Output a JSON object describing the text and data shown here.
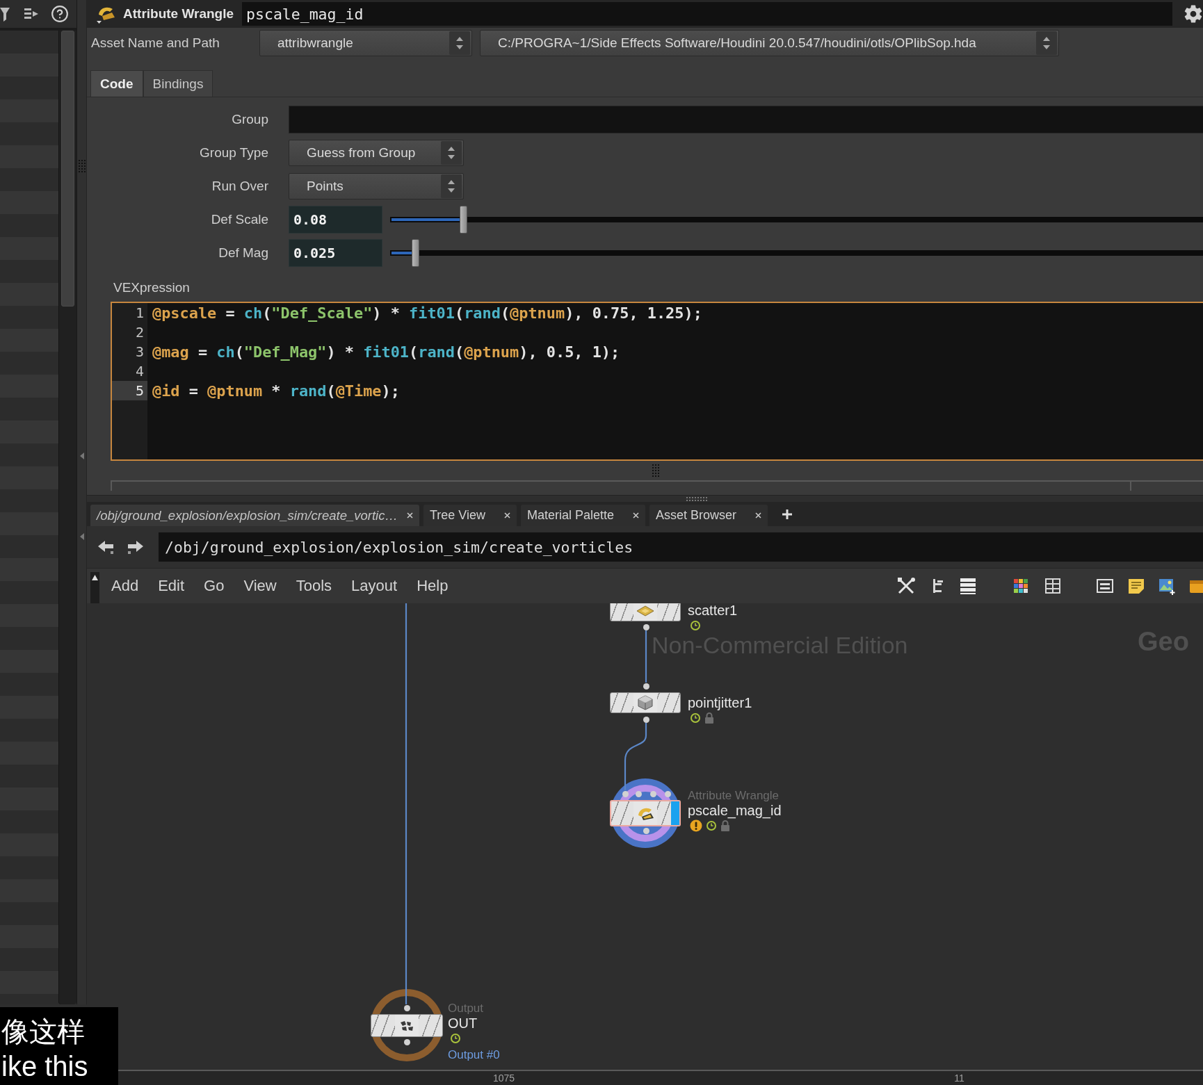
{
  "header": {
    "node_type": "Attribute Wrangle",
    "node_name": "pscale_mag_id"
  },
  "asset": {
    "label": "Asset Name and Path",
    "name": "attribwrangle",
    "path": "C:/PROGRA~1/Side Effects Software/Houdini 20.0.547/houdini/otls/OPlibSop.hda"
  },
  "parameter_tabs": [
    {
      "label": "Code",
      "selected": true
    },
    {
      "label": "Bindings",
      "selected": false
    }
  ],
  "parameters": [
    {
      "kind": "text",
      "label": "Group"
    },
    {
      "kind": "menu",
      "label": "Group Type",
      "value": "Guess from Group"
    },
    {
      "kind": "menu",
      "label": "Run Over",
      "value": "Points"
    },
    {
      "kind": "slider",
      "label": "Def Scale",
      "value": "0.08",
      "level": 0.08
    },
    {
      "kind": "slider",
      "label": "Def Mag",
      "value": "0.025",
      "level": 0.025
    }
  ],
  "code_editor": {
    "label": "VEXpression",
    "lines": [
      {
        "number": "1",
        "current": false,
        "tokens": [
          {
            "kind": "attribute",
            "text": "@pscale"
          },
          {
            "kind": "plain",
            "text": " = "
          },
          {
            "kind": "function",
            "text": "ch"
          },
          {
            "kind": "plain",
            "text": "("
          },
          {
            "kind": "string",
            "text": "\"Def_Scale\""
          },
          {
            "kind": "plain",
            "text": ") * "
          },
          {
            "kind": "function",
            "text": "fit01"
          },
          {
            "kind": "plain",
            "text": "("
          },
          {
            "kind": "function",
            "text": "rand"
          },
          {
            "kind": "plain",
            "text": "("
          },
          {
            "kind": "attribute",
            "text": "@ptnum"
          },
          {
            "kind": "plain",
            "text": "), 0.75, 1.25);"
          }
        ]
      },
      {
        "number": "2",
        "current": false
      },
      {
        "number": "3",
        "current": false,
        "tokens": [
          {
            "kind": "attribute",
            "text": "@mag"
          },
          {
            "kind": "plain",
            "text": " = "
          },
          {
            "kind": "function",
            "text": "ch"
          },
          {
            "kind": "plain",
            "text": "("
          },
          {
            "kind": "string",
            "text": "\"Def_Mag\""
          },
          {
            "kind": "plain",
            "text": ") * "
          },
          {
            "kind": "function",
            "text": "fit01"
          },
          {
            "kind": "plain",
            "text": "("
          },
          {
            "kind": "function",
            "text": "rand"
          },
          {
            "kind": "plain",
            "text": "("
          },
          {
            "kind": "attribute",
            "text": "@ptnum"
          },
          {
            "kind": "plain",
            "text": "), 0.5, 1);"
          }
        ]
      },
      {
        "number": "4",
        "current": false
      },
      {
        "number": "5",
        "current": true,
        "tokens": [
          {
            "kind": "attribute",
            "text": "@id"
          },
          {
            "kind": "plain",
            "text": " = "
          },
          {
            "kind": "attribute",
            "text": "@ptnum"
          },
          {
            "kind": "plain",
            "text": " * "
          },
          {
            "kind": "function",
            "text": "rand"
          },
          {
            "kind": "plain",
            "text": "("
          },
          {
            "kind": "attribute",
            "text": "@Time"
          },
          {
            "kind": "plain",
            "text": ");"
          }
        ]
      }
    ]
  },
  "network_tabs": [
    {
      "kind": "path",
      "label": "/obj/ground_explosion/explosion_sim/create_vortic…",
      "selected": true
    },
    {
      "kind": "pane",
      "label": "Tree View",
      "selected": false
    },
    {
      "kind": "pane",
      "label": "Material Palette",
      "selected": false
    },
    {
      "kind": "pane",
      "label": "Asset Browser",
      "selected": false
    }
  ],
  "path_bar": {
    "path": "/obj/ground_explosion/explosion_sim/create_vorticles"
  },
  "menu": [
    "Add",
    "Edit",
    "Go",
    "View",
    "Tools",
    "Layout",
    "Help"
  ],
  "network": {
    "edition_label": "Non-Commercial Edition",
    "context_label": "Geo",
    "nodes": [
      {
        "kind": "scatter",
        "name": "scatter1",
        "selected": false,
        "display_flag": false,
        "badges": [
          {
            "kind": "time"
          }
        ]
      },
      {
        "kind": "pointjitter",
        "name": "pointjitter1",
        "selected": false,
        "display_flag": false,
        "badges": [
          {
            "kind": "time"
          },
          {
            "kind": "lock"
          }
        ]
      },
      {
        "kind": "wrangle",
        "type_label": "Attribute Wrangle",
        "name": "pscale_mag_id",
        "selected": true,
        "display_flag": true,
        "badges": [
          {
            "kind": "warning"
          },
          {
            "kind": "time"
          },
          {
            "kind": "lock"
          }
        ]
      },
      {
        "kind": "output",
        "type_label": "Output",
        "name": "OUT",
        "selected": false,
        "display_flag": false,
        "badges": [
          {
            "kind": "time"
          }
        ],
        "output_label": "Output #0"
      }
    ]
  },
  "ruler": [
    "1075",
    "11"
  ],
  "subtitles": [
    "像这样",
    "ike this"
  ]
}
